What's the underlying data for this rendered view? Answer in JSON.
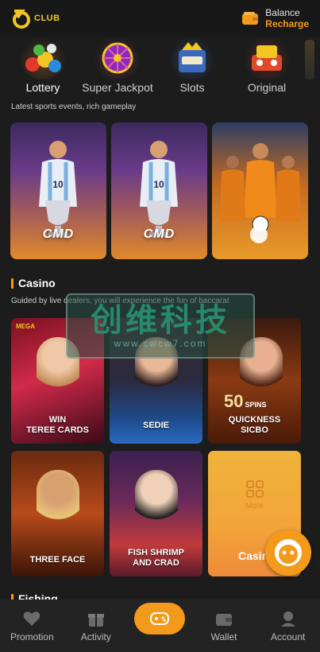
{
  "header": {
    "logo_text": "CLUB",
    "balance_label": "Balance",
    "recharge_label": "Recharge"
  },
  "categories": [
    {
      "label": "Lottery",
      "active": true
    },
    {
      "label": "Super Jackpot",
      "active": false
    },
    {
      "label": "Slots",
      "active": false
    },
    {
      "label": "Original",
      "active": false
    }
  ],
  "sports": {
    "subtitle": "Latest sports events, rich gameplay",
    "cards": [
      {
        "brand": "CMD"
      },
      {
        "brand": "CMD"
      },
      {
        "brand": ""
      }
    ]
  },
  "casino": {
    "title": "Casino",
    "subtitle": "Guided by live dealers, you will experience the fun of baccarat",
    "cards": [
      {
        "label": "WIN\nTEREE CARDS",
        "top_tag": "MEGA"
      },
      {
        "label": "SEDIE"
      },
      {
        "label": "QUICKNESS\nSICBO",
        "promo": "50",
        "promo_unit": "SPINS"
      },
      {
        "label": "THREE FACE"
      },
      {
        "label": "FISH SHRIMP\nAND CRAD"
      },
      {
        "label": "Casino",
        "more_label": "More"
      }
    ]
  },
  "fishing": {
    "title": "Fishing"
  },
  "watermark": {
    "big": "创维科技",
    "small": "www.cwcw7.com"
  },
  "nav": [
    {
      "label": "Promotion",
      "icon": "promotion-icon"
    },
    {
      "label": "Activity",
      "icon": "gift-icon"
    },
    {
      "label": "",
      "icon": "gamepad-icon"
    },
    {
      "label": "Wallet",
      "icon": "wallet-icon"
    },
    {
      "label": "Account",
      "icon": "account-icon"
    }
  ],
  "colors": {
    "accent": "#f39a1c",
    "logo": "#f3c623",
    "background": "#1c1c1c"
  }
}
